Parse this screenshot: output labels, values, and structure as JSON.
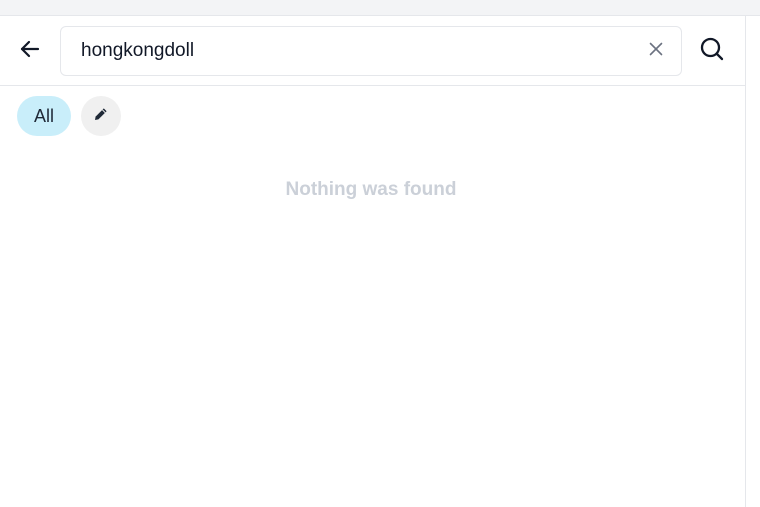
{
  "search": {
    "value": "hongkongdoll",
    "back_icon": "arrow-left-icon",
    "clear_icon": "close-icon",
    "submit_icon": "search-icon"
  },
  "filters": {
    "all_label": "All",
    "edit_icon": "pencil-icon"
  },
  "results": {
    "empty_message": "Nothing was found"
  },
  "colors": {
    "chip_active_bg": "#c9eefa",
    "empty_text": "#cbd0d8",
    "border": "#e5e7eb"
  }
}
